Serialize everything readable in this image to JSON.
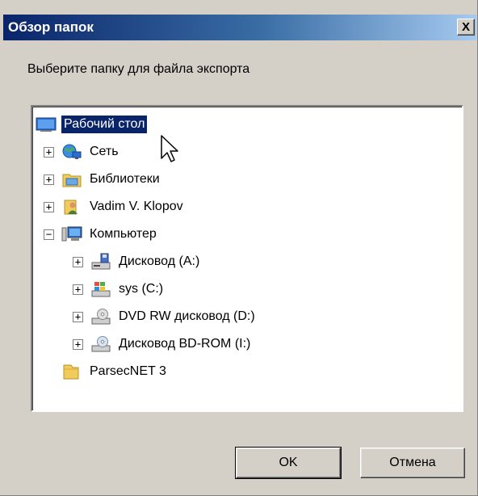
{
  "window": {
    "title": "Обзор папок",
    "close_glyph": "X"
  },
  "instruction": "Выберите папку для файла экспорта",
  "tree": [
    {
      "label": "Рабочий стол",
      "icon": "desktop-icon",
      "depth": 0,
      "expander": "",
      "selected": true
    },
    {
      "label": "Сеть",
      "icon": "network-icon",
      "depth": 1,
      "expander": "+",
      "selected": false
    },
    {
      "label": "Библиотеки",
      "icon": "libraries-icon",
      "depth": 1,
      "expander": "+",
      "selected": false
    },
    {
      "label": "Vadim V. Klopov",
      "icon": "user-folder-icon",
      "depth": 1,
      "expander": "+",
      "selected": false
    },
    {
      "label": "Компьютер",
      "icon": "computer-icon",
      "depth": 1,
      "expander": "−",
      "selected": false
    },
    {
      "label": "Дисковод (A:)",
      "icon": "floppy-drive-icon",
      "depth": 2,
      "expander": "+",
      "selected": false
    },
    {
      "label": "sys (C:)",
      "icon": "system-drive-icon",
      "depth": 2,
      "expander": "+",
      "selected": false
    },
    {
      "label": "DVD RW дисковод (D:)",
      "icon": "dvd-drive-icon",
      "depth": 2,
      "expander": "+",
      "selected": false
    },
    {
      "label": "Дисковод BD-ROM (I:)",
      "icon": "bd-drive-icon",
      "depth": 2,
      "expander": "+",
      "selected": false
    },
    {
      "label": "ParsecNET 3",
      "icon": "folder-icon",
      "depth": 1,
      "expander": "",
      "selected": false
    }
  ],
  "buttons": {
    "ok": "OK",
    "cancel": "Отмена"
  },
  "colors": {
    "selection": "#0a246a",
    "title_start": "#0a246a",
    "title_end": "#a6caf0",
    "face": "#d4d0c8"
  }
}
